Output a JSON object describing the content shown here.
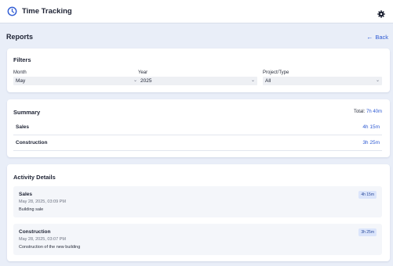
{
  "header": {
    "title": "Time Tracking",
    "icon": "clock-icon",
    "settings_icon": "gear-icon"
  },
  "page": {
    "title": "Reports",
    "back_label": "Back"
  },
  "filters": {
    "title": "Filters",
    "month": {
      "label": "Month",
      "value": "May"
    },
    "year": {
      "label": "Year",
      "value": "2025"
    },
    "project": {
      "label": "Project/Type",
      "value": "All"
    }
  },
  "summary": {
    "title": "Summary",
    "total_label": "Total:",
    "total_value": "7h 40m",
    "rows": [
      {
        "name": "Sales",
        "value": "4h 15m"
      },
      {
        "name": "Construction",
        "value": "3h 25m"
      }
    ]
  },
  "activity": {
    "title": "Activity Details",
    "items": [
      {
        "name": "Sales",
        "date": "May 28, 2025, 03:09 PM",
        "note": "Building sale",
        "duration": "4h 15m"
      },
      {
        "name": "Construction",
        "date": "May 28, 2025, 03:07 PM",
        "note": "Construction of the new building",
        "duration": "3h 25m"
      }
    ]
  },
  "colors": {
    "accent": "#2f5bd3",
    "background": "#e9eef8",
    "badge_bg": "#dbe5fb"
  }
}
